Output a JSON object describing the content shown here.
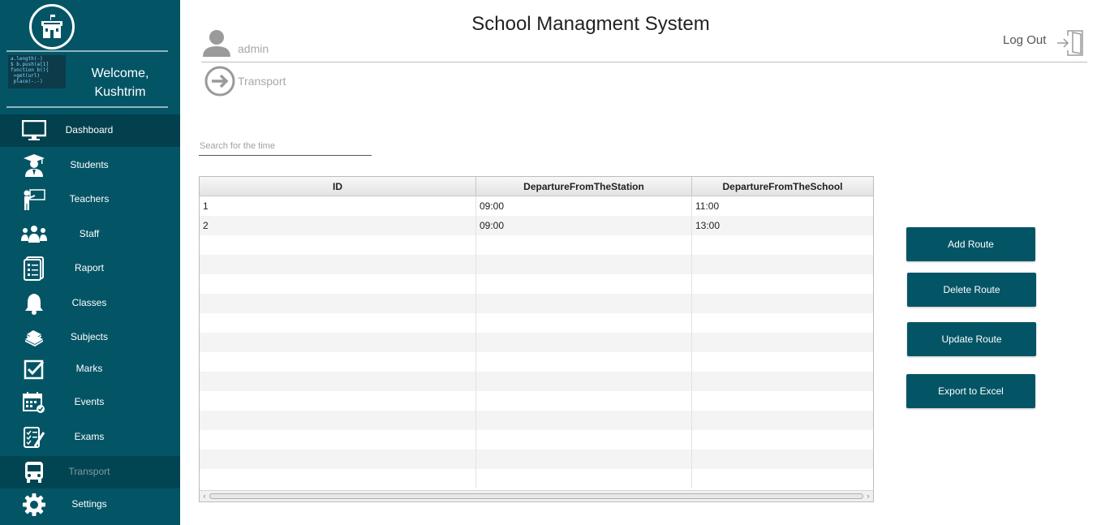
{
  "app": {
    "title": "School Managment System"
  },
  "header": {
    "user": {
      "name": "admin",
      "icon": "user-icon"
    },
    "logout": {
      "label": "Log Out",
      "icon": "logout-icon"
    },
    "breadcrumb": {
      "label": "Transport",
      "icon": "arrow-right-circle-icon"
    }
  },
  "sidebar": {
    "logo_icon": "school-icon",
    "welcome": {
      "greeting": "Welcome,",
      "name": "Kushtrim"
    },
    "avatar_code": "a.length(-)\n$ b.push(a[1]\nfunction b(){\n >get(url)\n place(-.-)",
    "items": [
      {
        "label": "Dashboard",
        "icon": "monitor-icon"
      },
      {
        "label": "Students",
        "icon": "student-icon"
      },
      {
        "label": "Teachers",
        "icon": "teacher-icon"
      },
      {
        "label": "Staff",
        "icon": "staff-icon"
      },
      {
        "label": "Raport",
        "icon": "report-icon"
      },
      {
        "label": "Classes",
        "icon": "bell-icon"
      },
      {
        "label": "Subjects",
        "icon": "books-icon"
      },
      {
        "label": "Marks",
        "icon": "checkbox-icon"
      },
      {
        "label": "Events",
        "icon": "calendar-icon"
      },
      {
        "label": "Exams",
        "icon": "exam-icon"
      },
      {
        "label": "Transport",
        "icon": "bus-icon"
      },
      {
        "label": "Settings",
        "icon": "gear-icon"
      }
    ],
    "active_item": "Dashboard",
    "current_item": "Transport"
  },
  "search": {
    "placeholder": "Search for the time",
    "value": ""
  },
  "table": {
    "columns": [
      "ID",
      "DepartureFromTheStation",
      "DepartureFromTheSchool"
    ],
    "rows": [
      [
        "1",
        "09:00",
        "11:00"
      ],
      [
        "2",
        "09:00",
        "13:00"
      ]
    ]
  },
  "actions": {
    "add": "Add Route",
    "delete": "Delete Route",
    "update": "Update Route",
    "export": "Export to Excel"
  },
  "colors": {
    "primary": "#035566",
    "primary_dark": "#02404d",
    "header_text": "#222222",
    "muted_text": "#a8a8a8"
  }
}
